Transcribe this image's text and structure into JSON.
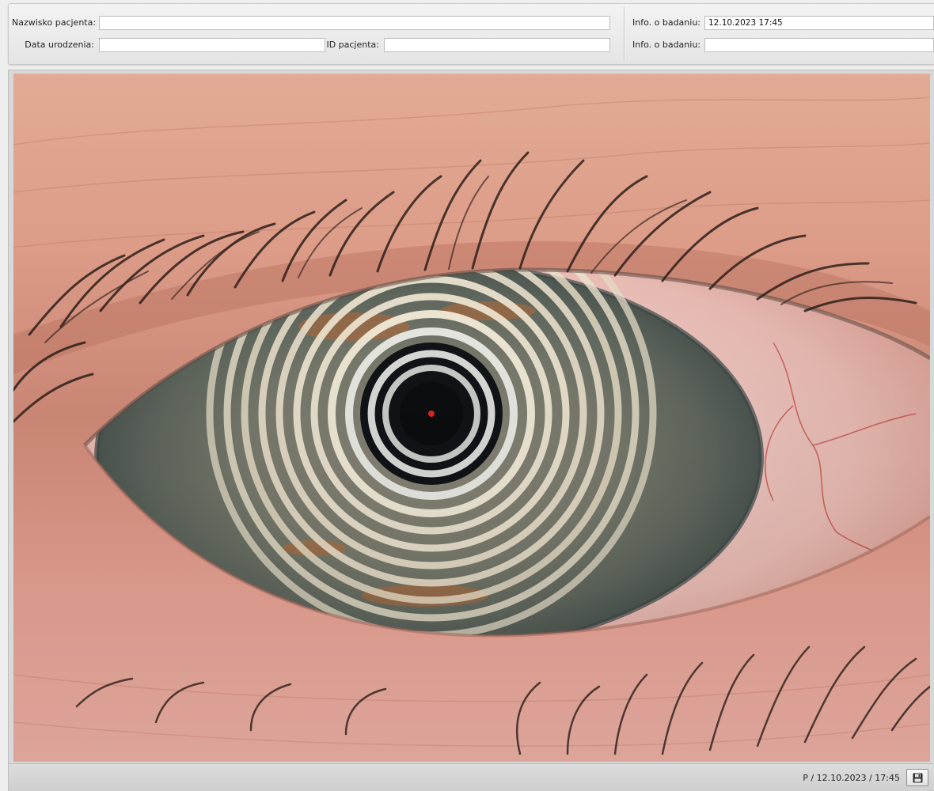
{
  "patient": {
    "surname_label": "Nazwisko pacjenta:",
    "surname_value": "",
    "birthdate_label": "Data urodzenia:",
    "birthdate_value": "",
    "id_label": "ID pacjenta:",
    "id_value": ""
  },
  "exam": {
    "info1_label": "Info. o badaniu:",
    "info1_value": "12.10.2023 17:45",
    "info2_label": "Info. o badaniu:",
    "info2_value": ""
  },
  "image": {
    "subject": "eye-placido-ring-photo"
  },
  "status": {
    "text": "P / 12.10.2023 / 17:45",
    "save_icon": "floppy-disk-icon"
  },
  "colors": {
    "header_bg": "#ececec",
    "field_bg": "#ffffff",
    "skin": "#d89a86",
    "iris": "#6f7567"
  }
}
